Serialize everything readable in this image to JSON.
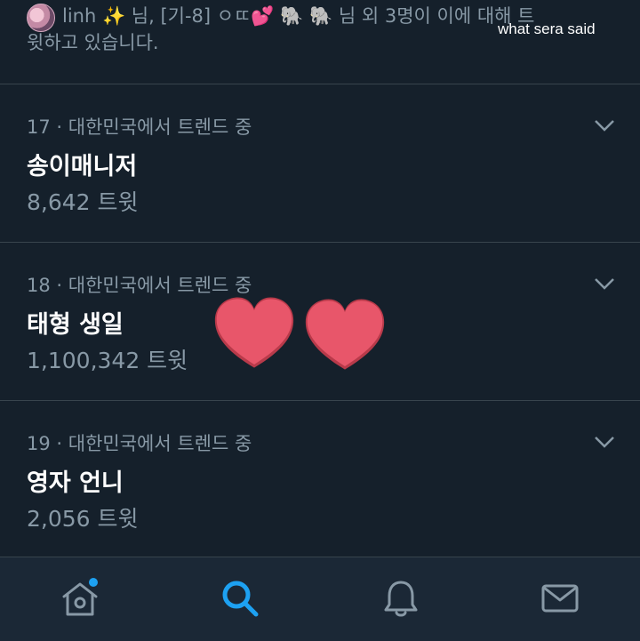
{
  "context": {
    "line1": "linh ✨ 님, [기-8] ㅇㄸ💕 🐘 🐘 님 외 3명이 이에 대해 트",
    "line2": "윗하고 있습니다.",
    "watermark": "what sera said"
  },
  "trends": [
    {
      "meta": "17 · 대한민국에서 트렌드 중",
      "name": "송이매니저",
      "count": "8,642 트윗"
    },
    {
      "meta": "18 · 대한민국에서 트렌드 중",
      "name": "태형 생일",
      "count": "1,100,342 트윗"
    },
    {
      "meta": "19 · 대한민국에서 트렌드 중",
      "name": "영자 언니",
      "count": "2,056 트윗"
    }
  ],
  "tabs": {
    "items": [
      "home-icon",
      "search-icon",
      "bell-icon",
      "mail-icon"
    ],
    "active": "search-icon",
    "active_color": "#1da1f2",
    "inactive_color": "#8899a6",
    "home_badge_color": "#1da1f2"
  },
  "colors": {
    "background": "#15202b",
    "divider": "#38444d",
    "secondary_text": "#8899a6",
    "heart": "#e8566a"
  }
}
